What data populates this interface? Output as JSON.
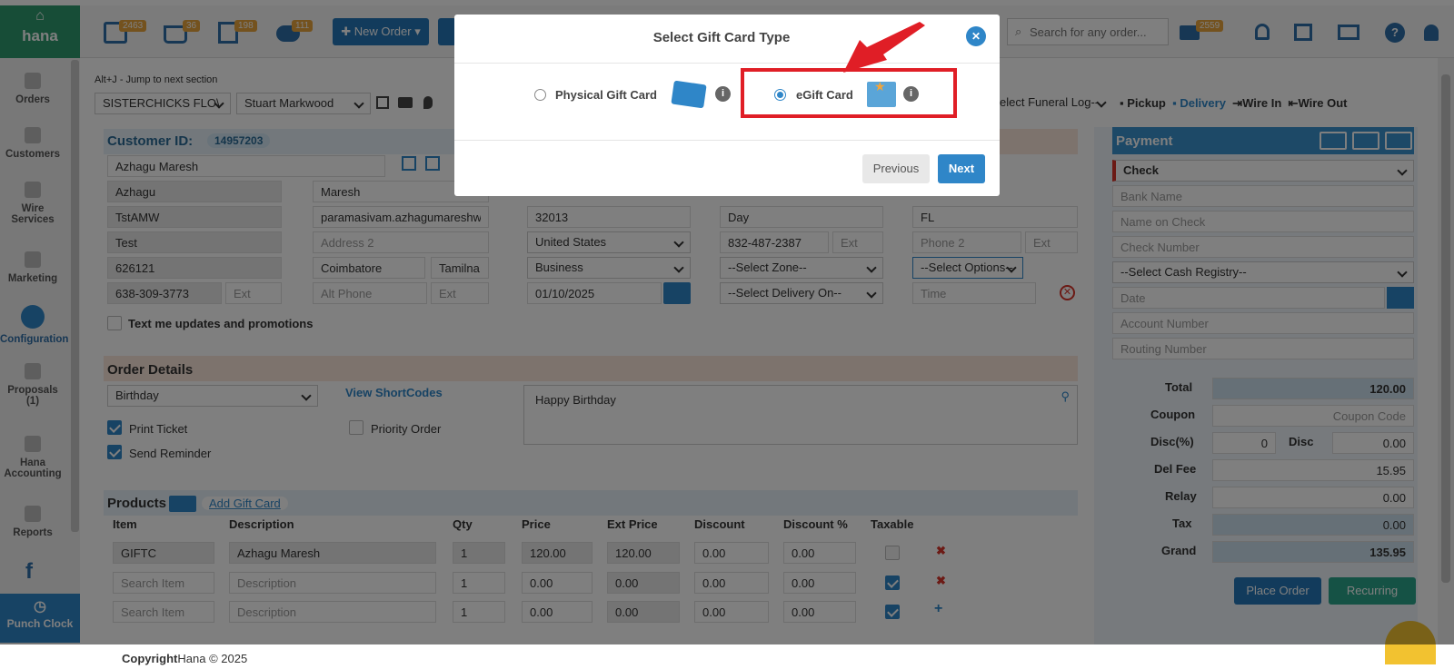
{
  "app": {
    "logo": "hana",
    "footer_bold": "Copyright",
    "footer_rest": "Hana © 2025"
  },
  "topbar": {
    "badges": [
      "2463",
      "36",
      "198",
      "111"
    ],
    "new_order": "New Order",
    "search_placeholder": "Search for any order...",
    "mail_badge": "2559"
  },
  "sidebar": [
    {
      "label": "Orders"
    },
    {
      "label": "Customers"
    },
    {
      "label": "Wire Services"
    },
    {
      "label": "Marketing"
    },
    {
      "label": "Configuration"
    },
    {
      "label": "Proposals (1)"
    },
    {
      "label": "Hana Accounting"
    },
    {
      "label": "Reports"
    }
  ],
  "punch_clock": "Punch Clock",
  "hint": "Alt+J - Jump to next section",
  "shop_select": "SISTERCHICKS FLO\\",
  "employee_select": "Stuart Markwood",
  "funeral_select": "elect Funeral Log--",
  "delivery_modes": [
    "Pickup",
    "Delivery",
    "Wire In",
    "Wire Out"
  ],
  "customer": {
    "label": "Customer ID:",
    "id": "14957203",
    "full_name": "Azhagu Maresh",
    "first": "Azhagu",
    "last": "Maresh",
    "company": "TstAMW",
    "email": "paramasivam.azhagumareshwai",
    "addr1": "Test",
    "addr2_ph": "Address 2",
    "zip": "626121",
    "city": "Coimbatore",
    "state": "Tamilna",
    "phone": "638-309-3773",
    "ext_ph": "Ext",
    "alt_phone_ph": "Alt Phone",
    "sms": "Text me updates and promotions"
  },
  "recipient": {
    "zip": "32013",
    "country": "United States",
    "location": "Business",
    "date": "01/10/2025",
    "city": "Day",
    "phone": "832-487-2387",
    "ext_ph": "Ext",
    "zone": "--Select Zone--",
    "delivery_on": "--Select Delivery On--",
    "state": "FL",
    "phone2_ph": "Phone 2",
    "options": "--Select Options--",
    "time_ph": "Time"
  },
  "order": {
    "title": "Order Details",
    "occasion": "Birthday",
    "shortcodes": "View ShortCodes",
    "card_message": "Happy Birthday",
    "print_ticket": "Print Ticket",
    "send_reminder": "Send Reminder",
    "priority": "Priority Order"
  },
  "products": {
    "title": "Products",
    "add_gift": "Add Gift Card",
    "headers": [
      "Item",
      "Description",
      "Qty",
      "Price",
      "Ext Price",
      "Discount",
      "Discount %",
      "Taxable"
    ],
    "rows": [
      {
        "item": "GIFTC",
        "desc": "Azhagu Maresh",
        "qty": "1",
        "price": "120.00",
        "ext": "120.00",
        "disc": "0.00",
        "discp": "0.00"
      },
      {
        "item": "",
        "desc": "",
        "qty": "1",
        "price": "0.00",
        "ext": "0.00",
        "disc": "0.00",
        "discp": "0.00"
      },
      {
        "item": "",
        "desc": "",
        "qty": "1",
        "price": "0.00",
        "ext": "0.00",
        "disc": "0.00",
        "discp": "0.00"
      }
    ],
    "item_ph": "Search Item",
    "desc_ph": "Description"
  },
  "payment": {
    "title": "Payment",
    "method": "Check",
    "bank_ph": "Bank Name",
    "name_ph": "Name on Check",
    "num_ph": "Check Number",
    "register": "--Select Cash Registry--",
    "date_ph": "Date",
    "acct_ph": "Account Number",
    "routing_ph": "Routing Number",
    "total_label": "Total",
    "total": "120.00",
    "coupon_label": "Coupon",
    "coupon_ph": "Coupon Code",
    "discp_label": "Disc(%)",
    "discp": "0",
    "disc_label": "Disc",
    "disc": "0.00",
    "delfee_label": "Del Fee",
    "delfee": "15.95",
    "relay_label": "Relay",
    "relay": "0.00",
    "tax_label": "Tax",
    "tax": "0.00",
    "grand_label": "Grand",
    "grand": "135.95",
    "place": "Place Order",
    "recurring": "Recurring"
  },
  "modal": {
    "title": "Select Gift Card Type",
    "physical": "Physical Gift Card",
    "egift": "eGift Card",
    "previous": "Previous",
    "next": "Next"
  }
}
